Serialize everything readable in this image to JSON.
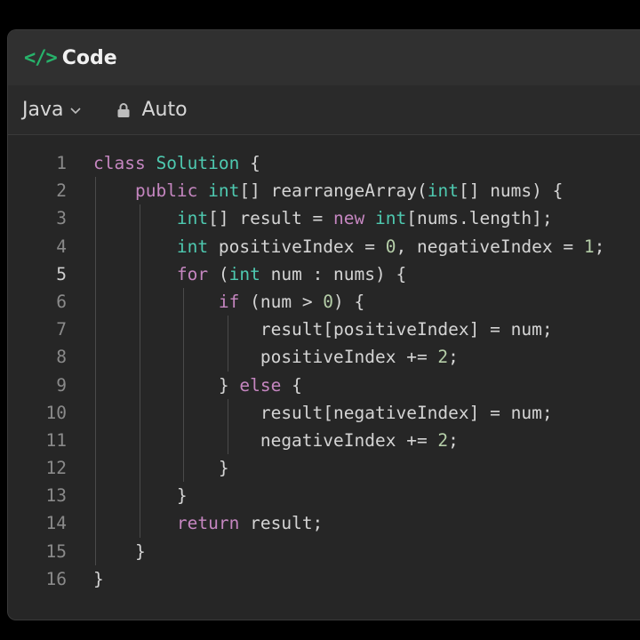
{
  "header": {
    "icon": "code-icon",
    "title": "Code"
  },
  "toolbar": {
    "language": "Java",
    "mode": "Auto"
  },
  "editor": {
    "active_line": 5,
    "lines": [
      {
        "n": "1",
        "text": "class Solution {"
      },
      {
        "n": "2",
        "text": "    public int[] rearrangeArray(int[] nums) {"
      },
      {
        "n": "3",
        "text": "        int[] result = new int[nums.length];"
      },
      {
        "n": "4",
        "text": "        int positiveIndex = 0, negativeIndex = 1;"
      },
      {
        "n": "5",
        "text": "        for (int num : nums) {"
      },
      {
        "n": "6",
        "text": "            if (num > 0) {"
      },
      {
        "n": "7",
        "text": "                result[positiveIndex] = num;"
      },
      {
        "n": "8",
        "text": "                positiveIndex += 2;"
      },
      {
        "n": "9",
        "text": "            } else {"
      },
      {
        "n": "10",
        "text": "                result[negativeIndex] = num;"
      },
      {
        "n": "11",
        "text": "                negativeIndex += 2;"
      },
      {
        "n": "12",
        "text": "            }"
      },
      {
        "n": "13",
        "text": "        }"
      },
      {
        "n": "14",
        "text": "        return result;"
      },
      {
        "n": "15",
        "text": "    }"
      },
      {
        "n": "16",
        "text": "}"
      }
    ]
  },
  "colors": {
    "accent": "#27b36b",
    "background": "#262626"
  }
}
